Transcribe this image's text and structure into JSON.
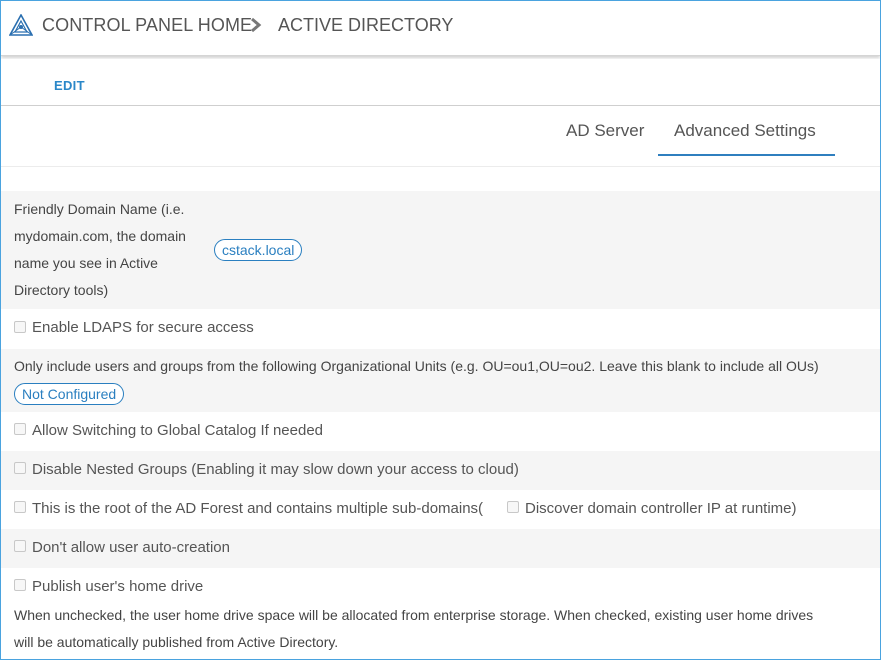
{
  "header": {
    "breadcrumb_home": "CONTROL PANEL HOME",
    "breadcrumb_current": "ACTIVE DIRECTORY",
    "logo_icon": "cluster-triangle-icon",
    "separator_icon": "chevron-right-icon"
  },
  "toolbar": {
    "edit_label": "EDIT"
  },
  "tabs": [
    {
      "label": "AD Server",
      "active": false
    },
    {
      "label": "Advanced Settings",
      "active": true
    }
  ],
  "settings": {
    "friendly_domain": {
      "label_lines": [
        "Friendly Domain Name (i.e.",
        "mydomain.com, the domain",
        "name you see in Active",
        "Directory tools)"
      ],
      "value": "cstack.local"
    },
    "ldaps": {
      "label": "Enable LDAPS for secure access",
      "checked": false
    },
    "ou_filter": {
      "label": "Only include users and groups from the following Organizational Units (e.g. OU=ou1,OU=ou2. Leave this blank to include all OUs)",
      "value": "Not Configured"
    },
    "global_catalog": {
      "label": "Allow Switching to Global Catalog If needed",
      "checked": false
    },
    "nested_groups": {
      "label": "Disable Nested Groups (Enabling it may slow down your access to cloud)",
      "checked": false
    },
    "root_forest": {
      "label": "This is the root of the AD Forest and contains multiple sub-domains(",
      "checked": false,
      "discover_label": "Discover domain controller IP at runtime)",
      "discover_checked": false
    },
    "auto_creation": {
      "label": "Don't allow user auto-creation",
      "checked": false
    },
    "home_drive": {
      "label": "Publish user's home drive",
      "checked": false,
      "note_lines": [
        "When unchecked, the user home drive space will be allocated from enterprise storage. When checked, existing user home drives",
        "will be automatically published from Active Directory."
      ]
    }
  },
  "colors": {
    "accent": "#2a87c8",
    "frame_border": "#4aa3df",
    "row_shade": "#f5f5f5"
  }
}
